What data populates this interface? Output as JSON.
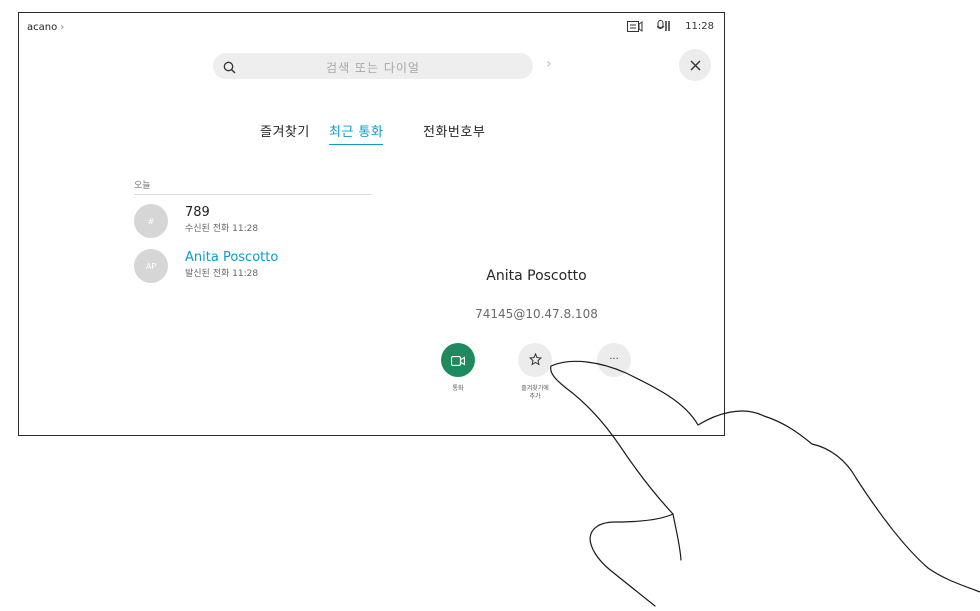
{
  "topbar": {
    "device_name": "acano",
    "device_chevron": "›",
    "time": "11:28",
    "icons": [
      "screen-share-icon",
      "mic-icon"
    ]
  },
  "search": {
    "placeholder": "검색 또는 다이얼",
    "go_icon": "chevron-right-icon"
  },
  "close_icon": "close-icon",
  "tabs": [
    {
      "label": "즐겨찾기",
      "active": false
    },
    {
      "label": "최근 통화",
      "active": true
    },
    {
      "label": "전화번호부",
      "active": false
    }
  ],
  "recents": {
    "section": "오늘",
    "items": [
      {
        "avatar": "#",
        "name": "789",
        "detail": "수신된 전화 11:28",
        "highlight": false
      },
      {
        "avatar": "AP",
        "name": "Anita Poscotto",
        "detail": "발신된 전화 11:28",
        "highlight": true
      }
    ]
  },
  "detail": {
    "name": "Anita Poscotto",
    "address": "74145@10.47.8.108",
    "actions": [
      {
        "label": "통화",
        "icon": "video-call-icon",
        "color": "#1f8a5e"
      },
      {
        "label": "즐겨찾기에\n추가",
        "icon": "star-icon"
      },
      {
        "label": "",
        "icon": "more-icon"
      }
    ]
  },
  "colors": {
    "accent": "#0d9bc7",
    "call_green": "#1f8a5e"
  }
}
